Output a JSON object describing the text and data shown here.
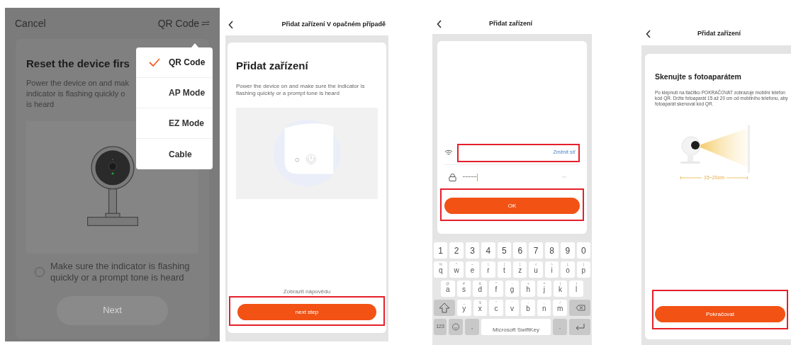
{
  "mode_screen": {
    "cancel": "Cancel",
    "mode_label": "QR Code",
    "title": "Reset the device firs",
    "description_lines": [
      "Power the device on and mak",
      "indicator is flashing quickly o",
      "is heard"
    ],
    "mode_menu": [
      {
        "label": "QR Code",
        "selected": true
      },
      {
        "label": "AP Mode",
        "selected": false
      },
      {
        "label": "EZ Mode",
        "selected": false
      },
      {
        "label": "Cable",
        "selected": false
      }
    ],
    "confirm": {
      "label": "Make sure the indicator is flashing quickly or a prompt tone is heard",
      "checked": false
    },
    "next_button": {
      "label": "Next",
      "disabled": true
    }
  },
  "intro_screen": {
    "title": "Přidat zařízení V opačném případě",
    "heading": "Přidat zařízení",
    "description": "Power the device on and make sure the indicator is flashing quickly or a prompt tone is heard",
    "help_link": "Zobrazit nápovědu",
    "button": {
      "label": "next step",
      "highlighted": true
    }
  },
  "wifi_screen": {
    "title": "Přidat zařízení",
    "network_field": {
      "action": "Změnit síť",
      "highlighted": true
    },
    "password_field": {
      "value": "···············"
    },
    "button": {
      "label": "OK",
      "highlighted": true
    },
    "keyboard": {
      "number_row": [
        "1",
        "2",
        "3",
        "4",
        "5",
        "6",
        "7",
        "8",
        "9",
        "0"
      ],
      "letter_rows": [
        [
          {
            "main": "q",
            "alt": "%"
          },
          {
            "main": "w",
            "alt": "^"
          },
          {
            "main": "e",
            "alt": "~"
          },
          {
            "main": "r",
            "alt": "|"
          },
          {
            "main": "t",
            "alt": "["
          },
          {
            "main": "z",
            "alt": "]"
          },
          {
            "main": "u",
            "alt": "<"
          },
          {
            "main": "i",
            "alt": ">"
          },
          {
            "main": "o",
            "alt": "{"
          },
          {
            "main": "p",
            "alt": "}"
          }
        ],
        [
          {
            "main": "a",
            "alt": "@"
          },
          {
            "main": "s",
            "alt": "#"
          },
          {
            "main": "d",
            "alt": "&"
          },
          {
            "main": "f",
            "alt": "*"
          },
          {
            "main": "g",
            "alt": "-"
          },
          {
            "main": "h",
            "alt": "+"
          },
          {
            "main": "j",
            "alt": "="
          },
          {
            "main": "k",
            "alt": "("
          },
          {
            "main": "l",
            "alt": ")"
          }
        ],
        [
          {
            "main": "y",
            "alt": "_"
          },
          {
            "main": "x",
            "alt": "$"
          },
          {
            "main": "c",
            "alt": "\""
          },
          {
            "main": "v",
            "alt": "'"
          },
          {
            "main": "b",
            "alt": ":"
          },
          {
            "main": "n",
            "alt": ";"
          },
          {
            "main": "m",
            "alt": "/"
          }
        ]
      ],
      "symbols_key": "123",
      "comma_key": ",",
      "space_key": "Microsoft SwiftKey",
      "period_key": "."
    }
  },
  "scan_screen": {
    "title": "Přidat zařízení",
    "heading": "Skenujte s fotoaparátem",
    "description": "Po klepnutí na tlačítko POKRAČOVAT zobrazuje mobilní telefon kód QR. Držte fotoaparát 15 až 20 cm od mobilního telefonu, aby fotoaparát skenoval kód QR.",
    "distance": "15~20cm",
    "button": {
      "label": "Pokračovat",
      "highlighted": true
    }
  }
}
